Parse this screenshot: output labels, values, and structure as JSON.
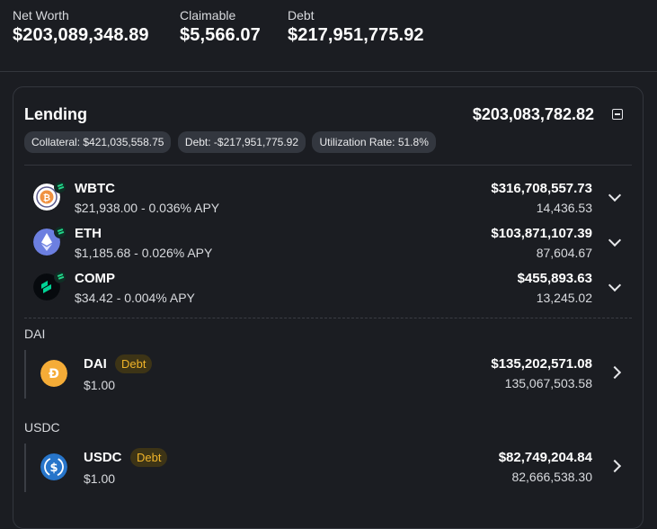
{
  "summary": {
    "net_worth_label": "Net Worth",
    "net_worth_value": "$203,089,348.89",
    "claimable_label": "Claimable",
    "claimable_value": "$5,566.07",
    "debt_label": "Debt",
    "debt_value": "$217,951,775.92"
  },
  "lending": {
    "title": "Lending",
    "total": "$203,083,782.82",
    "chips": {
      "collateral": "Collateral: $421,035,558.75",
      "debt": "Debt: -$217,951,775.92",
      "utilization": "Utilization Rate: 51.8%"
    },
    "supplied": [
      {
        "name": "WBTC",
        "sub": "$21,938.00 - 0.036% APY",
        "amount": "$316,708,557.73",
        "qty": "14,436.53",
        "icon": "wbtc-icon"
      },
      {
        "name": "ETH",
        "sub": "$1,185.68 - 0.026% APY",
        "amount": "$103,871,107.39",
        "qty": "87,604.67",
        "icon": "eth-icon"
      },
      {
        "name": "COMP",
        "sub": "$34.42 - 0.004% APY",
        "amount": "$455,893.63",
        "qty": "13,245.02",
        "icon": "comp-icon"
      }
    ],
    "groups": [
      {
        "label": "DAI",
        "name": "DAI",
        "tag": "Debt",
        "sub": "$1.00",
        "amount": "$135,202,571.08",
        "qty": "135,067,503.58",
        "icon": "dai-icon"
      },
      {
        "label": "USDC",
        "name": "USDC",
        "tag": "Debt",
        "sub": "$1.00",
        "amount": "$82,749,204.84",
        "qty": "82,666,538.30",
        "icon": "usdc-icon"
      }
    ]
  },
  "colors": {
    "background": "#1b1d22",
    "chip": "#33373f",
    "debt_tag_text": "#f0b429",
    "debt_tag_bg": "#3d3416",
    "badge_green": "#22d68a"
  }
}
